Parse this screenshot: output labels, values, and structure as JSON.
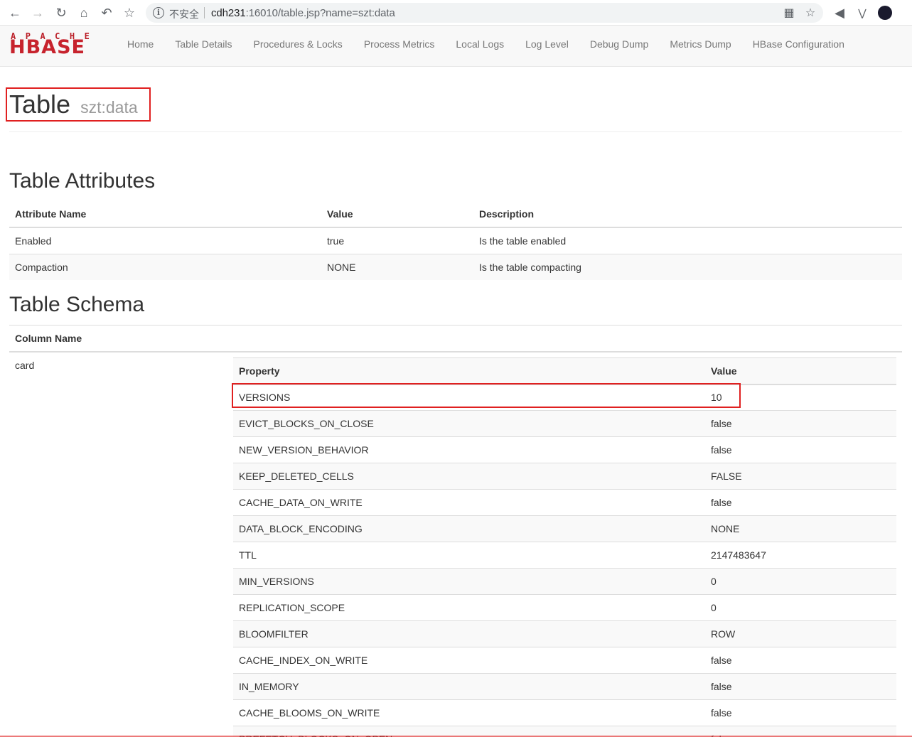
{
  "browser": {
    "insecure_label": "不安全",
    "url_host": "cdh231",
    "url_rest": ":16010/table.jsp?name=szt:data"
  },
  "navbar": {
    "logo_top": "APACHE",
    "logo_main": "HBASE",
    "links": [
      "Home",
      "Table Details",
      "Procedures & Locks",
      "Process Metrics",
      "Local Logs",
      "Log Level",
      "Debug Dump",
      "Metrics Dump",
      "HBase Configuration"
    ]
  },
  "header": {
    "title": "Table",
    "subtitle": "szt:data"
  },
  "attributes": {
    "heading": "Table Attributes",
    "columns": [
      "Attribute Name",
      "Value",
      "Description"
    ],
    "rows": [
      [
        "Enabled",
        "true",
        "Is the table enabled"
      ],
      [
        "Compaction",
        "NONE",
        "Is the table compacting"
      ]
    ]
  },
  "schema": {
    "heading": "Table Schema",
    "column_header": "Column Name",
    "family": "card",
    "prop_columns": [
      "Property",
      "Value"
    ],
    "properties": [
      [
        "VERSIONS",
        "10"
      ],
      [
        "EVICT_BLOCKS_ON_CLOSE",
        "false"
      ],
      [
        "NEW_VERSION_BEHAVIOR",
        "false"
      ],
      [
        "KEEP_DELETED_CELLS",
        "FALSE"
      ],
      [
        "CACHE_DATA_ON_WRITE",
        "false"
      ],
      [
        "DATA_BLOCK_ENCODING",
        "NONE"
      ],
      [
        "TTL",
        "2147483647"
      ],
      [
        "MIN_VERSIONS",
        "0"
      ],
      [
        "REPLICATION_SCOPE",
        "0"
      ],
      [
        "BLOOMFILTER",
        "ROW"
      ],
      [
        "CACHE_INDEX_ON_WRITE",
        "false"
      ],
      [
        "IN_MEMORY",
        "false"
      ],
      [
        "CACHE_BLOOMS_ON_WRITE",
        "false"
      ],
      [
        "PREFETCH_BLOCKS_ON_OPEN",
        "false"
      ]
    ]
  }
}
